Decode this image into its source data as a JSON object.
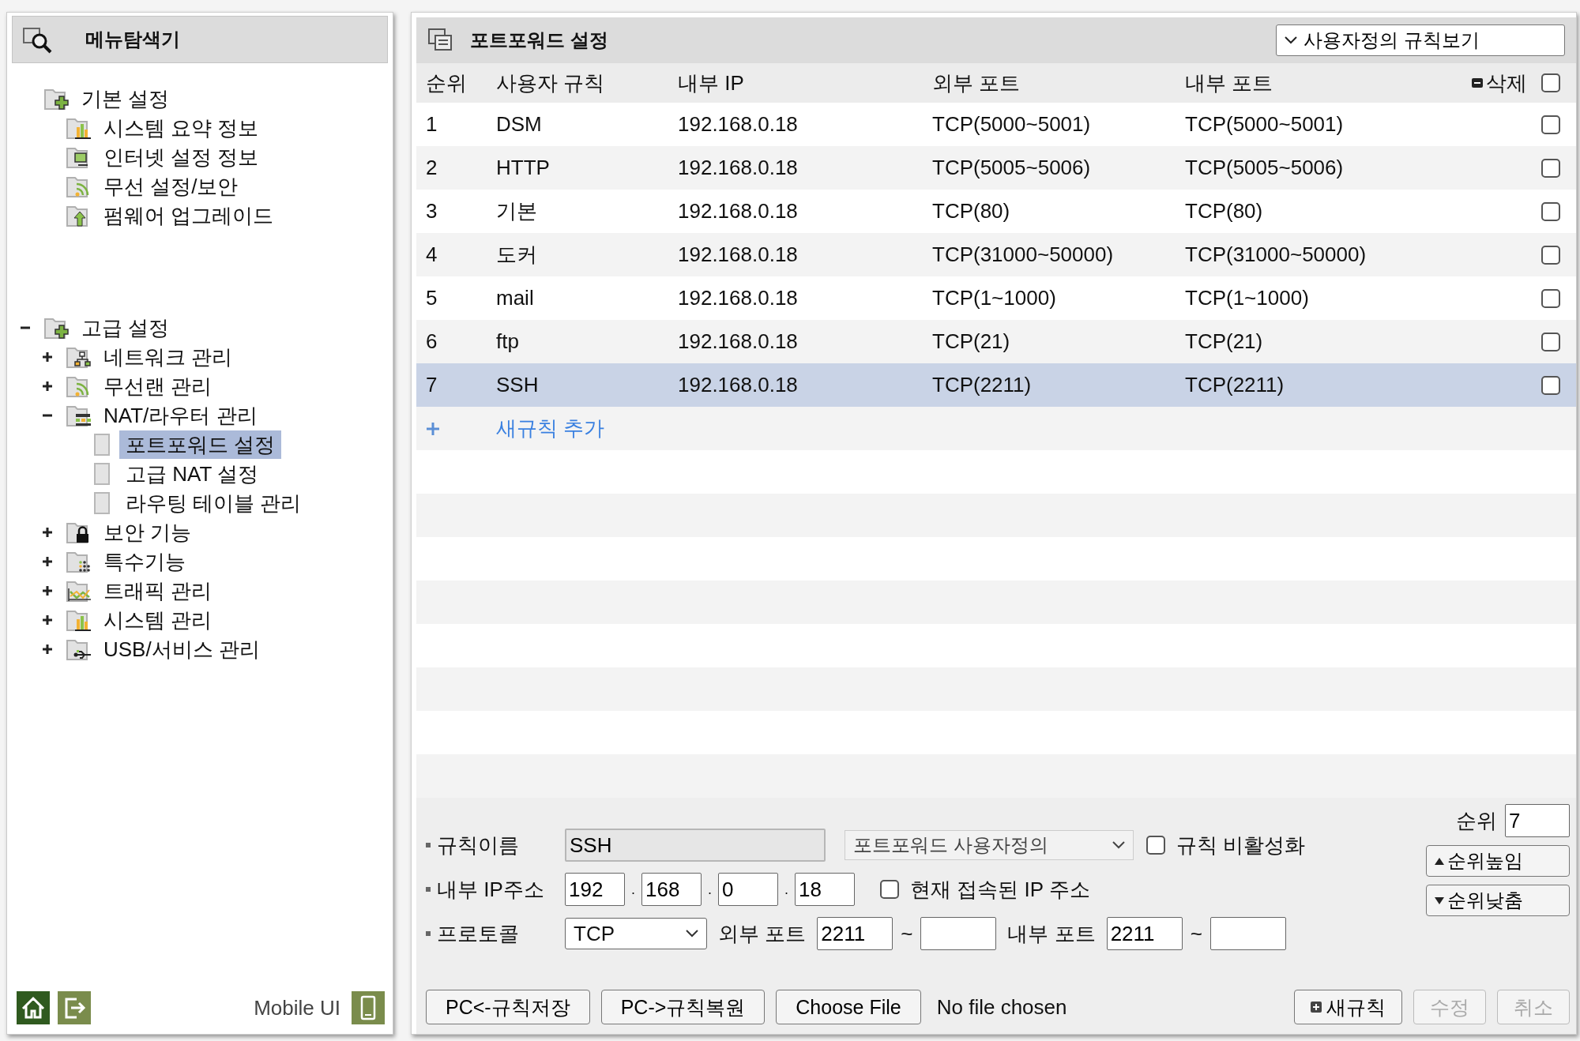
{
  "sidebar": {
    "title": "메뉴탐색기",
    "tree": [
      {
        "label": "기본 설정",
        "selected": false,
        "children": [
          {
            "label": "시스템 요약 정보",
            "selected": false
          },
          {
            "label": "인터넷 설정 정보",
            "selected": false
          },
          {
            "label": "무선 설정/보안",
            "selected": false
          },
          {
            "label": "펌웨어 업그레이드",
            "selected": false
          }
        ]
      },
      {
        "label": "고급 설정",
        "selected": false,
        "expanded": true,
        "children": [
          {
            "label": "네트워크 관리",
            "selected": false,
            "expanded": false
          },
          {
            "label": "무선랜 관리",
            "selected": false,
            "expanded": false
          },
          {
            "label": "NAT/라우터 관리",
            "selected": false,
            "expanded": true,
            "children": [
              {
                "label": "포트포워드 설정",
                "selected": true
              },
              {
                "label": "고급 NAT 설정",
                "selected": false
              },
              {
                "label": "라우팅 테이블 관리",
                "selected": false
              }
            ]
          },
          {
            "label": "보안 기능",
            "selected": false,
            "expanded": false
          },
          {
            "label": "특수기능",
            "selected": false,
            "expanded": false
          },
          {
            "label": "트래픽 관리",
            "selected": false,
            "expanded": false
          },
          {
            "label": "시스템 관리",
            "selected": false,
            "expanded": false
          },
          {
            "label": "USB/서비스 관리",
            "selected": false,
            "expanded": false
          }
        ]
      }
    ],
    "footer_label": "Mobile UI"
  },
  "panel": {
    "title": "포트포워드 설정",
    "view_dropdown": "사용자정의 규칙보기"
  },
  "table": {
    "columns": [
      "순위",
      "사용자 규칙",
      "내부 IP",
      "외부 포트",
      "내부 포트",
      "삭제"
    ],
    "select_all_checked": false,
    "rows": [
      {
        "cells": [
          "1",
          "DSM",
          "192.168.0.18",
          "TCP(5000~5001)",
          "TCP(5000~5001)"
        ],
        "checked": false,
        "selected": false
      },
      {
        "cells": [
          "2",
          "HTTP",
          "192.168.0.18",
          "TCP(5005~5006)",
          "TCP(5005~5006)"
        ],
        "checked": false,
        "selected": false
      },
      {
        "cells": [
          "3",
          "기본",
          "192.168.0.18",
          "TCP(80)",
          "TCP(80)"
        ],
        "checked": false,
        "selected": false
      },
      {
        "cells": [
          "4",
          "도커",
          "192.168.0.18",
          "TCP(31000~50000)",
          "TCP(31000~50000)"
        ],
        "checked": false,
        "selected": false
      },
      {
        "cells": [
          "5",
          "mail",
          "192.168.0.18",
          "TCP(1~1000)",
          "TCP(1~1000)"
        ],
        "checked": false,
        "selected": false
      },
      {
        "cells": [
          "6",
          "ftp",
          "192.168.0.18",
          "TCP(21)",
          "TCP(21)"
        ],
        "checked": false,
        "selected": false
      },
      {
        "cells": [
          "7",
          "SSH",
          "192.168.0.18",
          "TCP(2211)",
          "TCP(2211)"
        ],
        "checked": false,
        "selected": true
      }
    ],
    "add_link": "새규칙 추가"
  },
  "form": {
    "rule_name": {
      "label": "규칙이름",
      "value": "SSH"
    },
    "rule_type": "포트포워드 사용자정의",
    "disable_rule": {
      "label": "규칙 비활성화",
      "checked": false
    },
    "internal_ip": {
      "label": "내부 IP주소",
      "octets": [
        "192",
        "168",
        "0",
        "18"
      ],
      "separator": "."
    },
    "current_ip": {
      "label": "현재 접속된 IP 주소",
      "checked": false
    },
    "protocol": {
      "label": "프로토콜",
      "value": "TCP"
    },
    "external_port": {
      "label": "외부 포트",
      "start": "2211",
      "separator": "~"
    },
    "internal_port": {
      "label": "내부 포트",
      "start": "2211",
      "separator": "~"
    },
    "rank": {
      "label": "순위",
      "value": "7"
    },
    "move_up": "순위높임",
    "move_down": "순위낮춤",
    "backup_buttons": [
      "PC<-규칙저장",
      "PC->규칙복원"
    ],
    "file_button": "Choose File",
    "file_status": "No file chosen",
    "actions": [
      {
        "label": "새규칙",
        "disabled": false,
        "kind": "new"
      },
      {
        "label": "수정",
        "disabled": true,
        "kind": "plain"
      },
      {
        "label": "취소",
        "disabled": true,
        "kind": "plain"
      }
    ]
  }
}
